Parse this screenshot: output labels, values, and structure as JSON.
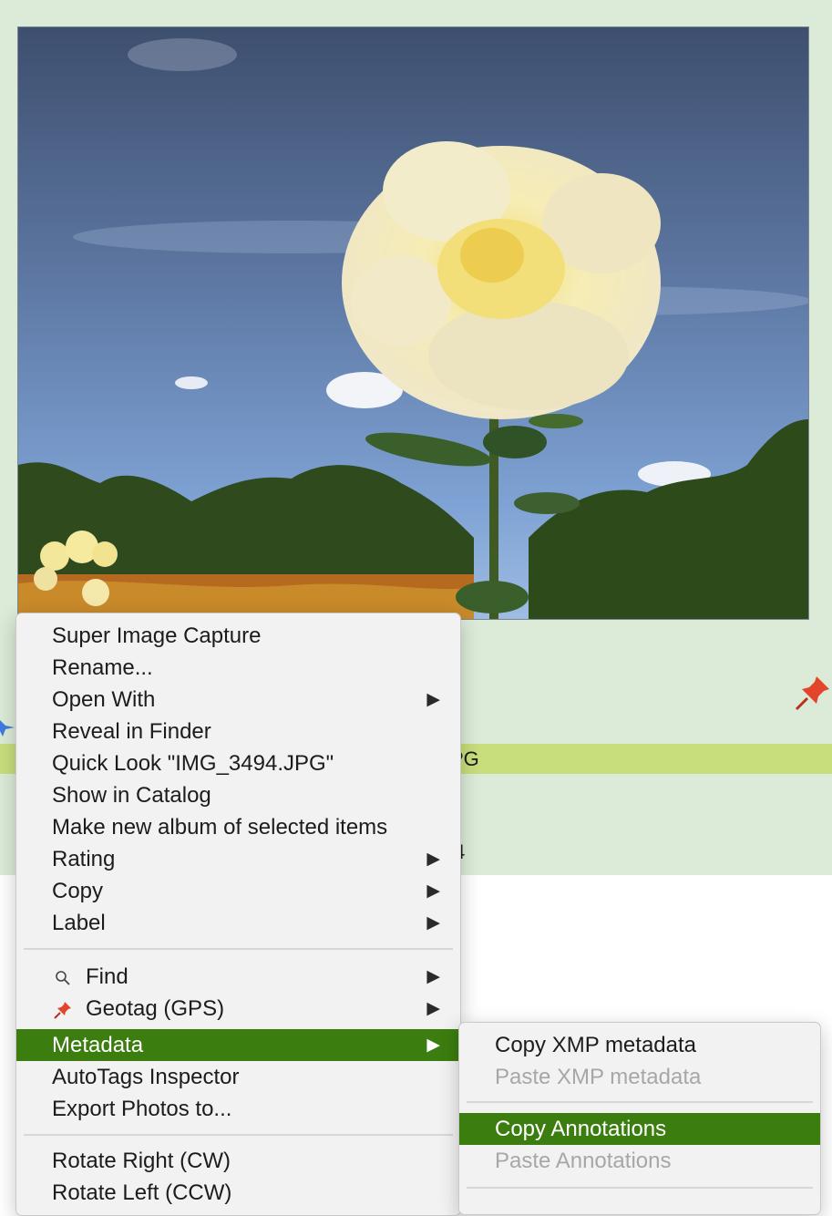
{
  "cell": {
    "filename_partial": "PG",
    "digit_partial": "4",
    "pin_icon": "pushpin-icon",
    "star_icon": "star-icon"
  },
  "photo": {
    "description_icon": "photo-thumbnail"
  },
  "menu": {
    "items": [
      {
        "label": "Super Image Capture"
      },
      {
        "label": "Rename..."
      },
      {
        "label": "Open With",
        "arrow": "▶"
      },
      {
        "label": "Reveal in Finder"
      },
      {
        "label": "Quick Look \"IMG_3494.JPG\""
      },
      {
        "label": "Show in Catalog"
      },
      {
        "label": "Make new album of selected items"
      },
      {
        "label": "Rating",
        "arrow": "▶"
      },
      {
        "label": "Copy",
        "arrow": "▶"
      },
      {
        "label": "Label",
        "arrow": "▶"
      },
      {
        "label": "Find",
        "arrow": "▶",
        "icon": "magnifier-icon"
      },
      {
        "label": "Geotag (GPS)",
        "arrow": "▶",
        "icon": "pushpin-icon"
      },
      {
        "label": "Metadata",
        "arrow": "▶"
      },
      {
        "label": "AutoTags Inspector"
      },
      {
        "label": "Export Photos to..."
      },
      {
        "label": "Rotate Right (CW)"
      },
      {
        "label": "Rotate Left (CCW)"
      }
    ]
  },
  "submenu": {
    "items": [
      {
        "label": "Copy XMP metadata"
      },
      {
        "label": "Paste XMP metadata"
      },
      {
        "label": "Copy Annotations"
      },
      {
        "label": "Paste Annotations"
      }
    ]
  },
  "colors": {
    "highlight": "#3c7d0f",
    "cell_bg": "#dcebd8",
    "filename_bar": "#c8de7c"
  }
}
